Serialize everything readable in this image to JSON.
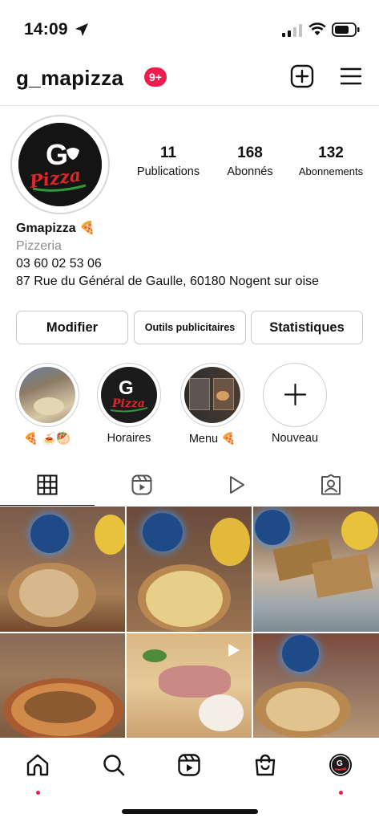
{
  "status_bar": {
    "time": "14:09"
  },
  "header": {
    "username": "g_mapizza",
    "notification_badge": "9+"
  },
  "profile": {
    "avatar_text": "G",
    "avatar_sub": "Pizza",
    "stats": [
      {
        "value": "11",
        "label": "Publications"
      },
      {
        "value": "168",
        "label": "Abonnés"
      },
      {
        "value": "132",
        "label": "Abonnements"
      }
    ],
    "display_name": "Gmapizza 🍕",
    "category": "Pizzeria",
    "phone": "03 60 02 53 06",
    "address": "87 Rue du Général de Gaulle, 60180 Nogent sur oise"
  },
  "actions": {
    "edit_label": "Modifier",
    "tools_label": "Outils publicitaires",
    "stats_label": "Statistiques"
  },
  "highlights": [
    {
      "label": "🍕 🍝🥙"
    },
    {
      "label": "Horaires"
    },
    {
      "label": "Menu 🍕"
    },
    {
      "label": "Nouveau"
    }
  ],
  "tabs": [
    "grid",
    "reels",
    "videos",
    "tagged"
  ],
  "colors": {
    "accent": "#ef1c4f",
    "border": "#c9c9c9",
    "muted": "#8e8e8e"
  }
}
